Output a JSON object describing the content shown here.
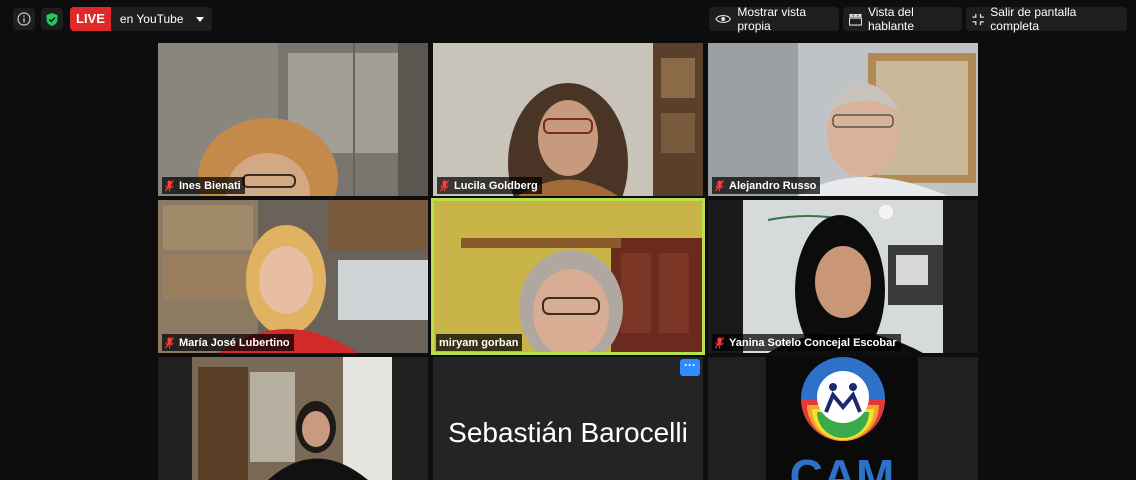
{
  "topbar": {
    "live_badge": "LIVE",
    "live_destination": "en YouTube",
    "own_view_label": "Mostrar vista propia",
    "speaker_view_label": "Vista del hablante",
    "exit_fullscreen_label": "Salir de pantalla completa"
  },
  "participants": [
    {
      "name": "Ines Bienati",
      "muted": true
    },
    {
      "name": "Lucila Goldberg",
      "muted": true
    },
    {
      "name": "Alejandro Russo",
      "muted": true
    },
    {
      "name": "María José Lubertino",
      "muted": true
    },
    {
      "name": "miryam gorban",
      "muted": false,
      "active_speaker": true
    },
    {
      "name": "Yanina Sotelo Concejal Escobar",
      "muted": true
    },
    {
      "name": "",
      "muted": false
    },
    {
      "name": "Sebastián Barocelli",
      "video_off": true
    },
    {
      "name": "",
      "muted": false,
      "logo_text": "CAM"
    }
  ],
  "colors": {
    "live_red": "#e02828",
    "active_speaker_border": "#b8e04a",
    "mute_icon_red": "#ff3b3b",
    "security_green": "#22c55e",
    "more_button_blue": "#2d8cff"
  }
}
